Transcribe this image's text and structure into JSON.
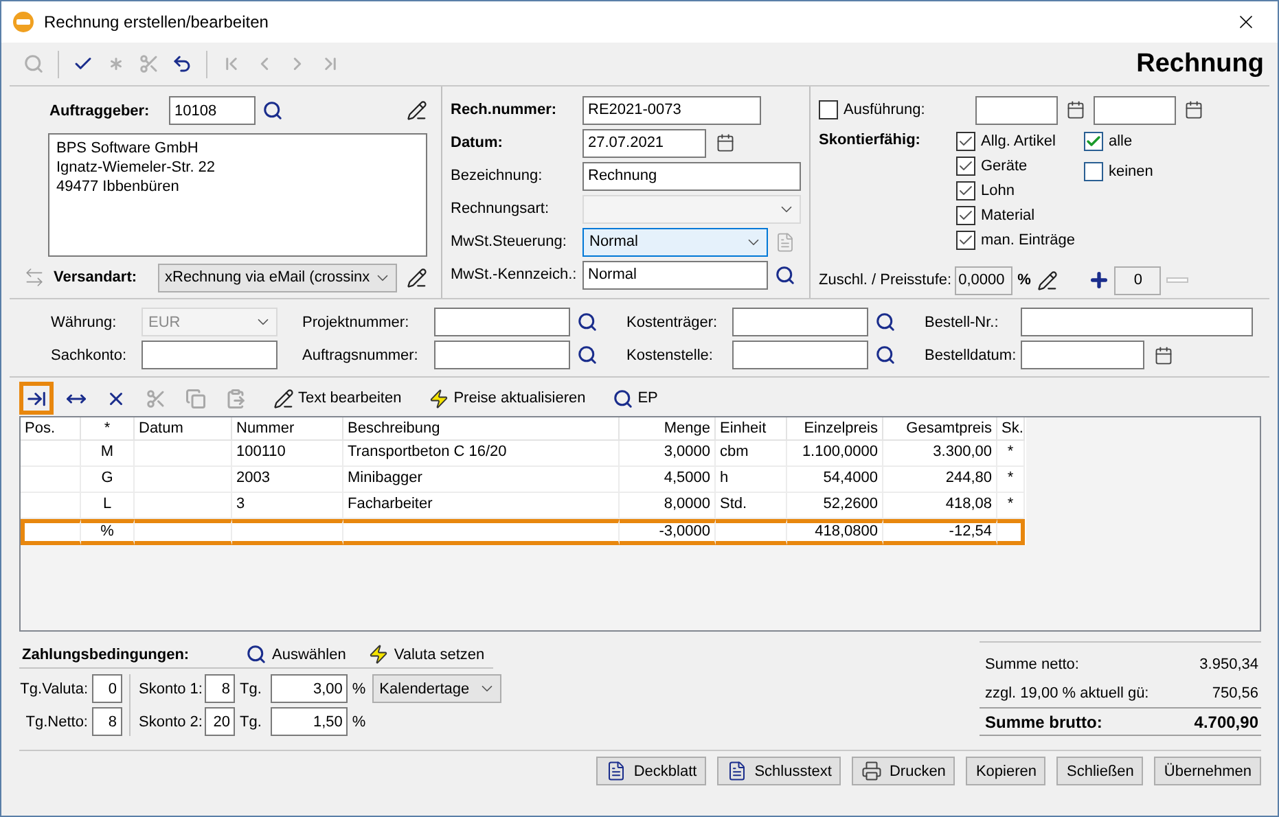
{
  "window": {
    "title": "Rechnung erstellen/bearbeiten"
  },
  "toolbar": {
    "heading": "Rechnung",
    "tools": [
      {
        "kind": "search",
        "disabled": true
      },
      {
        "kind": "check",
        "disabled": false
      },
      {
        "kind": "asterisk",
        "disabled": true
      },
      {
        "kind": "scissors",
        "disabled": true
      },
      {
        "kind": "undo",
        "disabled": false
      },
      {
        "kind": "first",
        "disabled": true
      },
      {
        "kind": "prev",
        "disabled": true
      },
      {
        "kind": "next",
        "disabled": true
      },
      {
        "kind": "last",
        "disabled": true
      }
    ]
  },
  "customer": {
    "label": "Auftraggeber:",
    "number": "10108",
    "address": [
      "BPS Software GmbH",
      "Ignatz-Wiemeler-Str. 22",
      "49477 Ibbenbüren"
    ],
    "shipping_label": "Versandart:",
    "shipping": "xRechnung via eMail (crossinx"
  },
  "invoice_fields": [
    {
      "label": "Rech.nummer:",
      "bold": true,
      "kind": "text",
      "value": "RE2021-0073"
    },
    {
      "label": "Datum:",
      "bold": true,
      "kind": "date",
      "value": "27.07.2021"
    },
    {
      "label": "Bezeichnung:",
      "bold": false,
      "kind": "wide",
      "value": "Rechnung"
    },
    {
      "label": "Rechnungsart:",
      "bold": false,
      "kind": "select",
      "disabled": true,
      "focused": false
    },
    {
      "label": "MwSt.Steuerung:",
      "bold": false,
      "kind": "select",
      "value": "Normal",
      "disabled": false,
      "focused": true
    },
    {
      "label": "MwSt.-Kennzeich.:",
      "bold": false,
      "kind": "lookup",
      "value": "Normal"
    }
  ],
  "execution": {
    "label": "Ausführung:",
    "checked": false
  },
  "discountable": {
    "label": "Skontierfähig:",
    "items": [
      {
        "label": "Allg. Artikel",
        "checked": true
      },
      {
        "label": "Geräte",
        "checked": true
      },
      {
        "label": "Lohn",
        "checked": true
      },
      {
        "label": "Material",
        "checked": true
      },
      {
        "label": "man. Einträge",
        "checked": true
      }
    ],
    "all": {
      "label": "alle",
      "checked": true
    },
    "none": {
      "label": "keinen",
      "checked": false
    }
  },
  "surcharge": {
    "label": "Zuschl. / Preisstufe:",
    "value": "0,0000",
    "unit": "%",
    "step": "0"
  },
  "extra_fields": [
    {
      "label": "Währung:",
      "kind": "select",
      "value": "EUR",
      "disabled": true
    },
    {
      "label": "Projektnummer:",
      "kind": "lookup"
    },
    {
      "label": "Kostenträger:",
      "kind": "lookup"
    },
    {
      "label": "Bestell-Nr.:",
      "kind": "wide"
    },
    {
      "label": "Sachkonto:",
      "kind": "text"
    },
    {
      "label": "Auftragsnummer:",
      "kind": "lookup"
    },
    {
      "label": "Kostenstelle:",
      "kind": "lookup"
    },
    {
      "label": "Bestelldatum:",
      "kind": "date"
    }
  ],
  "items_toolbar": [
    {
      "kind": "insert",
      "highlighted": true,
      "disabled": false
    },
    {
      "kind": "move",
      "highlighted": false,
      "disabled": false
    },
    {
      "kind": "delete",
      "highlighted": false,
      "disabled": false
    },
    {
      "kind": "cut",
      "highlighted": false,
      "disabled": true
    },
    {
      "kind": "copy",
      "highlighted": false,
      "disabled": true
    },
    {
      "kind": "paste",
      "highlighted": false,
      "disabled": true
    },
    {
      "kind": "edit",
      "label": "Text bearbeiten",
      "highlighted": false,
      "disabled": false
    },
    {
      "kind": "lightning",
      "label": "Preise aktualisieren",
      "highlighted": false,
      "disabled": false
    },
    {
      "kind": "search",
      "label": "EP",
      "highlighted": false,
      "disabled": false
    }
  ],
  "table": {
    "columns": [
      {
        "label": "Pos."
      },
      {
        "label": "*"
      },
      {
        "label": "Datum"
      },
      {
        "label": "Nummer"
      },
      {
        "label": "Beschreibung"
      },
      {
        "label": "Menge"
      },
      {
        "label": "Einheit"
      },
      {
        "label": "Einzelpreis"
      },
      {
        "label": "Gesamtpreis"
      },
      {
        "label": "Sk."
      }
    ],
    "rows": [
      {
        "type": "M",
        "number": "100110",
        "description": "Transportbeton C 16/20",
        "quantity": "3,0000",
        "unit": "cbm",
        "unit_price": "1.100,0000",
        "total": "3.300,00",
        "sk": "*",
        "highlighted": false
      },
      {
        "type": "G",
        "number": "2003",
        "description": "Minibagger",
        "quantity": "4,5000",
        "unit": "h",
        "unit_price": "54,4000",
        "total": "244,80",
        "sk": "*",
        "highlighted": false
      },
      {
        "type": "L",
        "number": "3",
        "description": "Facharbeiter",
        "quantity": "8,0000",
        "unit": "Std.",
        "unit_price": "52,2600",
        "total": "418,08",
        "sk": "*",
        "highlighted": false
      },
      {
        "type": "%",
        "quantity": "-3,0000",
        "unit_price": "418,0800",
        "total": "-12,54",
        "highlighted": true
      }
    ]
  },
  "payment": {
    "title": "Zahlungsbedingungen:",
    "actions": [
      {
        "kind": "search",
        "label": "Auswählen"
      },
      {
        "kind": "lightning",
        "label": "Valuta setzen"
      }
    ],
    "valuta_label": "Tg.Valuta:",
    "valuta": "0",
    "netto_label": "Tg.Netto:",
    "netto": "8",
    "discounts": [
      {
        "label": "Skonto 1:",
        "days": "8",
        "days_unit": "Tg.",
        "percent": "3,00",
        "unit": "%"
      },
      {
        "label": "Skonto 2:",
        "days": "20",
        "days_unit": "Tg.",
        "percent": "1,50",
        "unit": "%"
      }
    ],
    "day_type": "Kalendertage"
  },
  "totals": [
    {
      "label": "Summe netto:",
      "value": "3.950,34",
      "bold": false
    },
    {
      "label": "zzgl. 19,00 % aktuell gü:",
      "value": "750,56",
      "bold": false
    },
    {
      "label": "Summe brutto:",
      "value": "4.700,90",
      "bold": true
    }
  ],
  "buttons": [
    {
      "label": "Deckblatt",
      "kind": "document"
    },
    {
      "label": "Schlusstext",
      "kind": "document"
    },
    {
      "label": "Drucken",
      "kind": "printer"
    },
    {
      "label": "Kopieren",
      "kind": "plain"
    },
    {
      "label": "Schließen",
      "kind": "plain"
    },
    {
      "label": "Übernehmen",
      "kind": "plain"
    }
  ]
}
